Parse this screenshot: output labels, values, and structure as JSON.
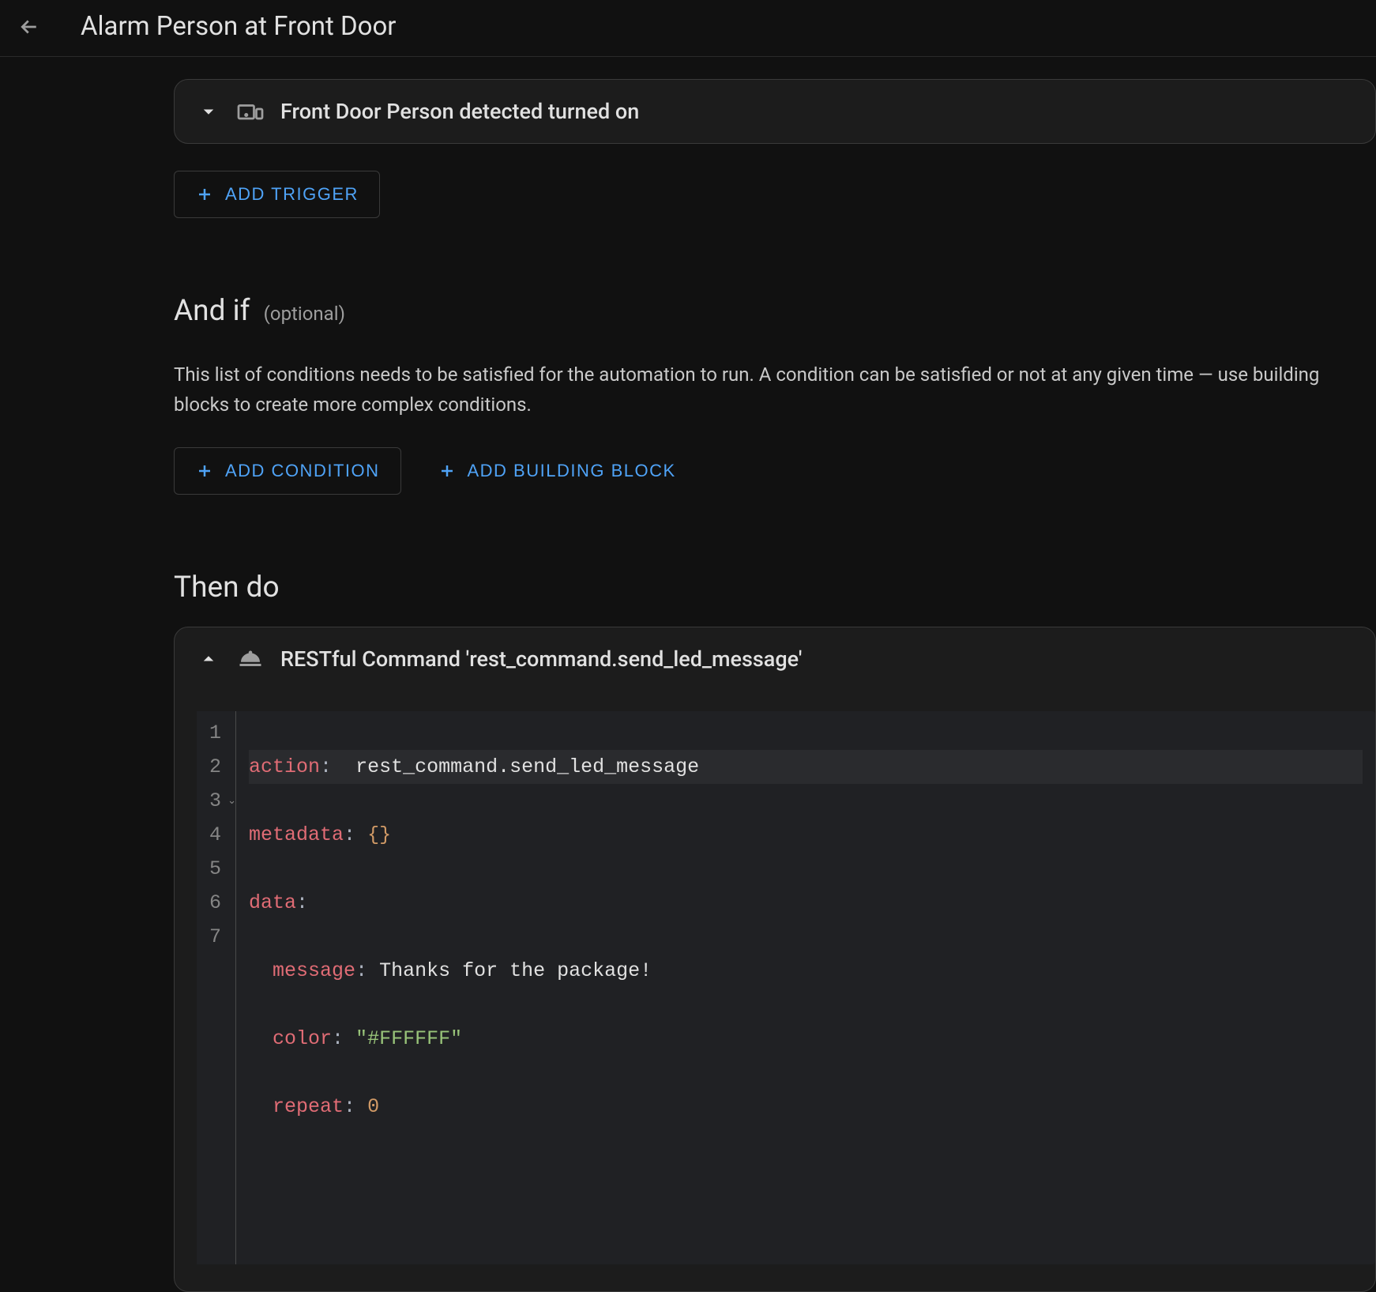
{
  "header": {
    "title": "Alarm Person at Front Door"
  },
  "trigger": {
    "card_title": "Front Door Person detected turned on",
    "add_trigger_label": "Add Trigger"
  },
  "conditions": {
    "section_title": "And if",
    "section_subtitle": "(optional)",
    "description": "This list of conditions needs to be satisfied for the automation to run. A condition can be satisfied or not at any given time — use building blocks to create more complex conditions.",
    "add_condition_label": "Add Condition",
    "add_building_block_label": "Add Building Block"
  },
  "actions": {
    "section_title": "Then do",
    "card_title": "RESTful Command 'rest_command.send_led_message'",
    "yaml": {
      "action_key": "action",
      "action_val": "rest_command.send_led_message",
      "metadata_key": "metadata",
      "metadata_val": "{}",
      "data_key": "data",
      "message_key": "message",
      "message_val": "Thanks for the package!",
      "color_key": "color",
      "color_val": "\"#FFFFFF\"",
      "repeat_key": "repeat",
      "repeat_val": "0",
      "line_numbers": [
        "1",
        "2",
        "3",
        "4",
        "5",
        "6",
        "7"
      ]
    }
  }
}
